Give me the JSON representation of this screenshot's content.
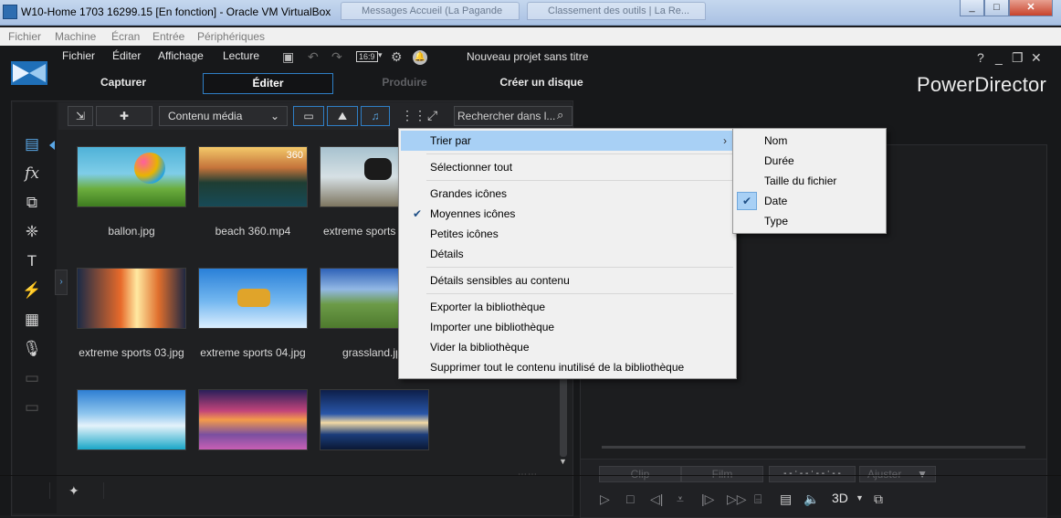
{
  "window": {
    "title": "W10-Home 1703 16299.15 [En fonction] - Oracle VM VirtualBox",
    "bg_tab_1": "Messages Accueil (La Pagande",
    "bg_tab_2": "Classement des outils | La Re...",
    "min": "_",
    "max": "□",
    "close": "✕"
  },
  "vbox_menu": [
    "Fichier",
    "Machine",
    "Écran",
    "Entrée",
    "Périphériques"
  ],
  "app": {
    "menu": [
      "Fichier",
      "Éditer",
      "Affichage",
      "Lecture"
    ],
    "aspect_ratio": "16:9",
    "project_title": "Nouveau projet sans titre",
    "brand": "PowerDirector",
    "help": "?",
    "tabs": [
      "Capturer",
      "Éditer",
      "Produire",
      "Créer un disque"
    ]
  },
  "library": {
    "content_dropdown": "Contenu média",
    "search_placeholder": "Rechercher dans l...",
    "items": [
      {
        "label": "ballon.jpg"
      },
      {
        "label": "beach 360.mp4",
        "badge": "360"
      },
      {
        "label": "extreme sports 0"
      },
      {
        "label": "extreme sports 03.jpg"
      },
      {
        "label": "extreme sports 04.jpg"
      },
      {
        "label": "grassland.jp"
      },
      {
        "label": ""
      },
      {
        "label": ""
      },
      {
        "label": ""
      }
    ]
  },
  "context_menu": {
    "items": [
      "Trier par",
      "Sélectionner tout",
      "Grandes icônes",
      "Moyennes icônes",
      "Petites icônes",
      "Détails",
      "Détails sensibles au contenu",
      "Exporter la bibliothèque",
      "Importer une bibliothèque",
      "Vider la bibliothèque",
      "Supprimer tout le contenu inutilisé de la bibliothèque"
    ],
    "checked": "Moyennes icônes",
    "highlighted": "Trier par"
  },
  "sort_submenu": {
    "items": [
      "Nom",
      "Durée",
      "Taille du fichier",
      "Date",
      "Type"
    ],
    "checked": "Date"
  },
  "preview": {
    "clip": "Clip",
    "film": "Film",
    "timecode": "- - : - - : - - : - -",
    "fit": "Ajuster",
    "mode_3d": "3D"
  },
  "colors": {
    "accent": "#2f7fc6",
    "menu_highlight": "#a8d0f5"
  }
}
